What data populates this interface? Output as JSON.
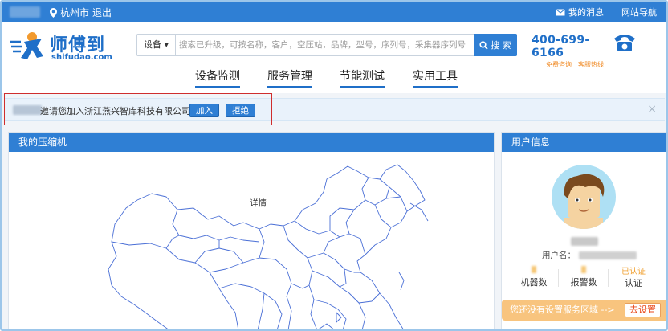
{
  "topbar": {
    "city": "杭州市",
    "logout": "退出",
    "messages": "我的消息",
    "site_nav": "网站导航"
  },
  "logo": {
    "name": "师傅到",
    "domain": "shifudao.com"
  },
  "search": {
    "category": "设备",
    "placeholder": "搜索已升级，可按名称，客户，空压站，品牌，型号，序列号，采集器序列号搜索",
    "button": "搜 索"
  },
  "hotline": {
    "number": "400-699-6166",
    "sub1": "免费咨询",
    "sub2": "客服热线"
  },
  "menu": [
    "设备监测",
    "服务管理",
    "节能测试",
    "实用工具"
  ],
  "invite": {
    "text": "邀请您加入浙江燕兴智库科技有限公司!",
    "accept": "加入",
    "reject": "拒绝",
    "close": "×"
  },
  "left_panel": {
    "title": "我的压缩机",
    "map_tip": "详情"
  },
  "right_panel": {
    "title": "用户信息",
    "username_label": "用户名：",
    "stats": [
      {
        "value": "",
        "label": "机器数"
      },
      {
        "value": "",
        "label": "报警数"
      },
      {
        "value": "已认证",
        "label": "认证"
      }
    ],
    "service_text": "您还没有设置服务区域 -->",
    "service_button": "去设置"
  },
  "colors": {
    "brand_blue": "#2f7fd4",
    "warning_orange": "#f8c47e",
    "alert_red": "#e94a1c"
  }
}
